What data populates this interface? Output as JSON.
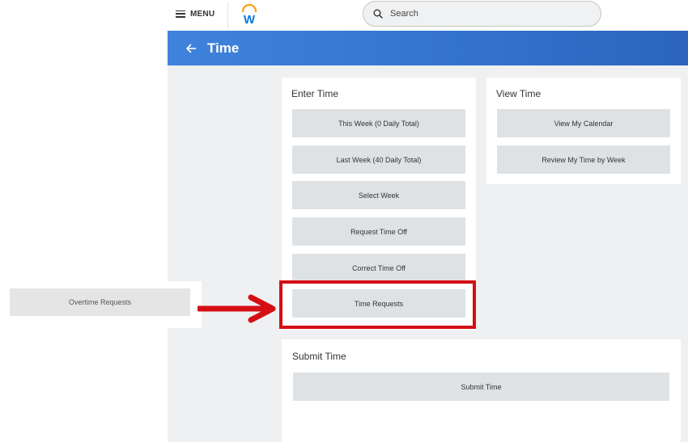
{
  "topbar": {
    "menu_label": "MENU",
    "logo_letter": "W",
    "search_placeholder": "Search"
  },
  "header": {
    "title": "Time"
  },
  "enter_time": {
    "title": "Enter Time",
    "buttons": [
      "This Week (0 Daily Total)",
      "Last Week (40 Daily Total)",
      "Select Week",
      "Request Time Off",
      "Correct Time Off",
      "Time Requests"
    ]
  },
  "view_time": {
    "title": "View Time",
    "buttons": [
      "View My Calendar",
      "Review My Time by Week"
    ]
  },
  "submit_time": {
    "title": "Submit Time",
    "button": "Submit Time"
  },
  "callout": {
    "label": "Overtime Requests"
  },
  "colors": {
    "header_blue": "#3272cd",
    "highlight_red": "#d40f14",
    "button_gray": "#dfe2e4",
    "logo_orange": "#f5a623",
    "logo_blue": "#0875e1"
  },
  "icons": [
    "hamburger-icon",
    "workday-logo",
    "search-icon",
    "back-arrow-icon",
    "red-arrow-icon"
  ]
}
